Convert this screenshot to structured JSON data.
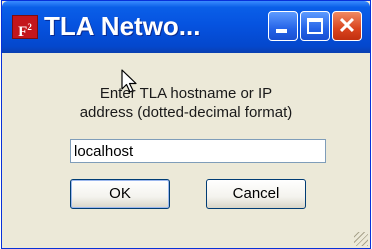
{
  "window": {
    "title": "TLA Netwo...",
    "app_icon_text": "F",
    "app_icon_sup": "2",
    "app_icon_color": "#c4161c",
    "titlebar_color": "#0653e0",
    "close_button_color": "#d9441e",
    "controls": {
      "minimize_icon": "minimize-icon",
      "maximize_icon": "maximize-icon",
      "close_icon": "close-icon",
      "close_glyph": "✕"
    }
  },
  "dialog": {
    "prompt_line1": "Enter TLA hostname or IP",
    "prompt_line2": "address (dotted-decimal format)",
    "hostname_value": "localhost",
    "ok_label": "OK",
    "cancel_label": "Cancel"
  }
}
